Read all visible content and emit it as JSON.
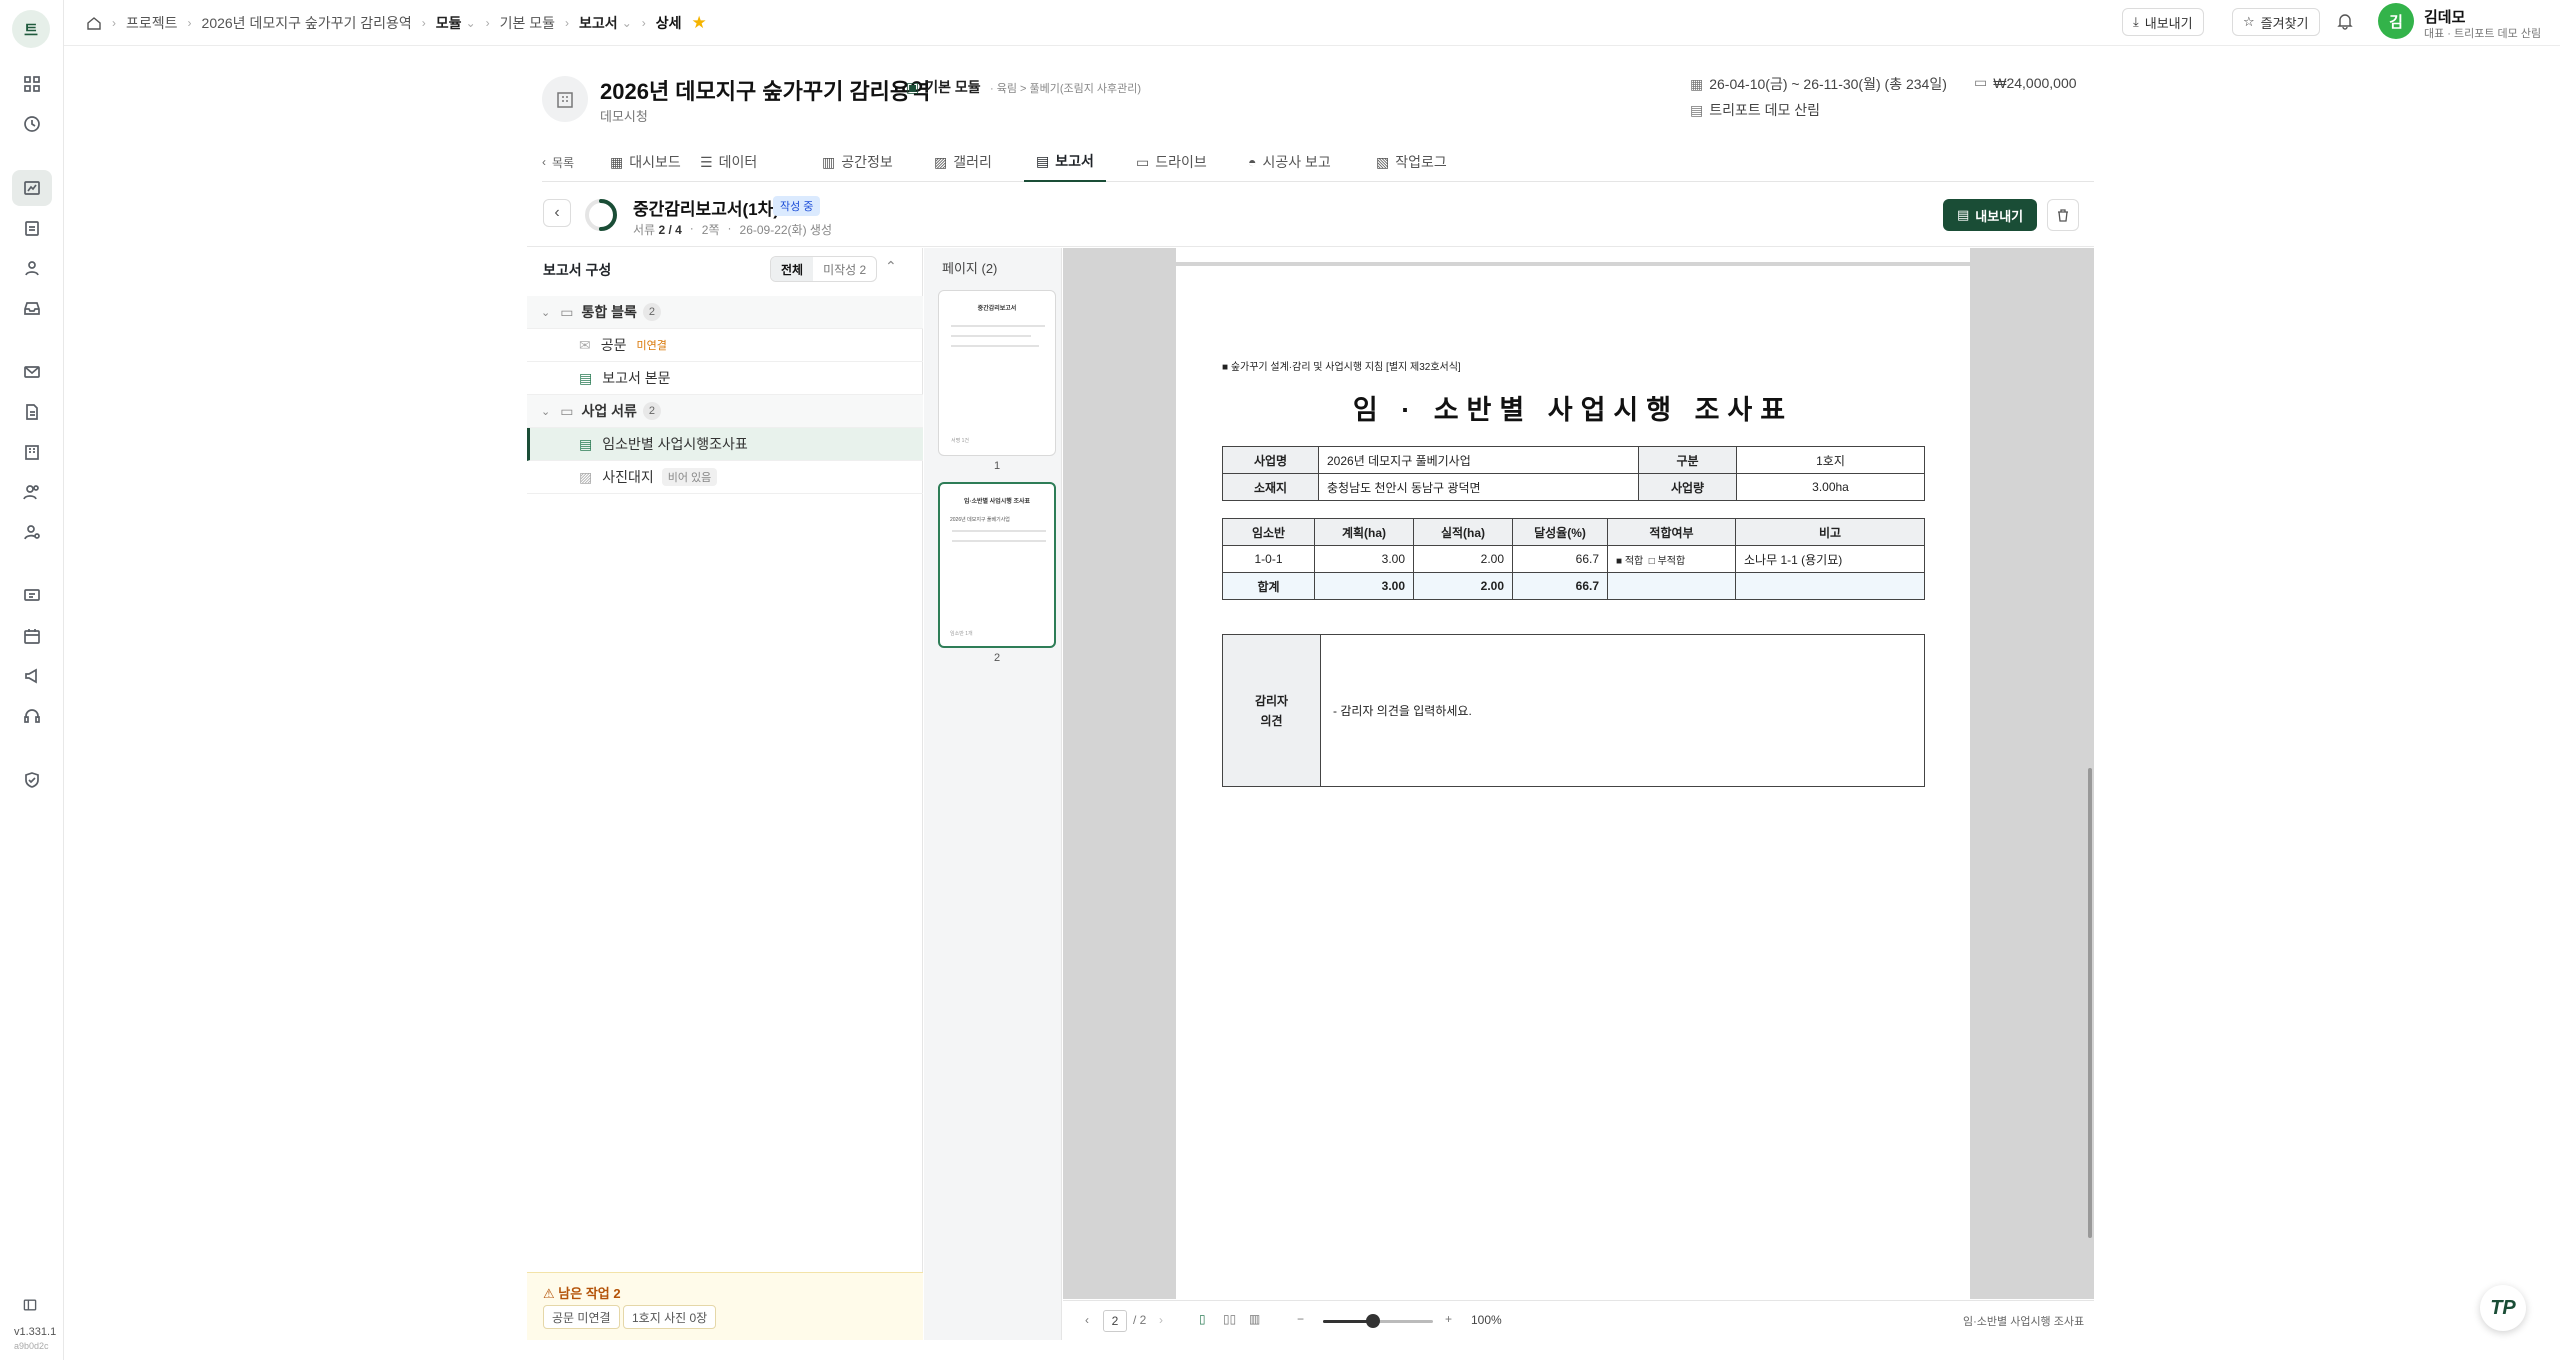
{
  "rail": {
    "logo": "트",
    "version": "v1.331.1",
    "build": "a9b0d2c"
  },
  "breadcrumb": {
    "items": [
      "프로젝트",
      "2026년 데모지구 숲가꾸기 감리용역",
      "모듈",
      "기본 모듈",
      "보고서",
      "상세"
    ]
  },
  "topbar": {
    "export_label": "내보내기",
    "favorite_label": "즐겨찾기",
    "avatar_letter": "김",
    "user_name": "김데모",
    "user_role": "대표 · 트리포트 데모 산림"
  },
  "project": {
    "title": "2026년 데모지구 숲가꾸기 감리용역",
    "client": "데모시청",
    "module_label": "기본 모듈",
    "module_path": "· 육림 > 풀베기(조림지 사후관리)",
    "period": "26-04-10(금) ~ 26-11-30(월) (총 234일)",
    "amount": "₩24,000,000",
    "company": "트리포트 데모 산림"
  },
  "tabs": {
    "back_label": "목록",
    "items": [
      "대시보드",
      "데이터",
      "공간정보",
      "갤러리",
      "보고서",
      "드라이브",
      "시공사 보고",
      "작업로그"
    ]
  },
  "report": {
    "title": "중간감리보고서(1차)",
    "status": "작성 중",
    "docs_label": "서류",
    "docs_value": "2 / 4",
    "pages": "2쪽",
    "created": "26-09-22(화) 생성",
    "export_label": "내보내기"
  },
  "tree": {
    "title": "보고서 구성",
    "filter_all": "전체",
    "filter_pending": "미작성 2",
    "groups": [
      {
        "label": "통합 블록",
        "count": "2"
      },
      {
        "label": "사업 서류",
        "count": "2"
      }
    ],
    "items": [
      {
        "label": "공문",
        "tag": "미연결"
      },
      {
        "label": "보고서 본문",
        "tag": ""
      },
      {
        "label": "임소반별 사업시행조사표",
        "tag": ""
      },
      {
        "label": "사진대지",
        "tag": "비어 있음"
      }
    ],
    "footer_title": "남은 작업 2",
    "footer_chips": [
      "공문 미연결",
      "1호지 사진 0장"
    ]
  },
  "thumbs": {
    "title": "페이지 (2)",
    "pages": [
      {
        "num": "1",
        "title": "중간감리보고서",
        "foot": "서명 1건"
      },
      {
        "num": "2",
        "title": "임·소반별 사업시행 조사표",
        "sub": "2026년 데모지구 풀베기사업",
        "foot": "임소반 1개"
      }
    ]
  },
  "doc": {
    "note": "■ 숲가꾸기 설계·감리 및 사업시행 지침 [별지 제32호서식]",
    "title": "임 · 소반별 사업시행 조사표",
    "info": {
      "project_label": "사업명",
      "project_value": "2026년 데모지구 풀베기사업",
      "type_label": "구분",
      "type_value": "1호지",
      "location_label": "소재지",
      "location_value": "충청남도 천안시 동남구 광덕면",
      "amount_label": "사업량",
      "amount_value": "3.00ha"
    },
    "table": {
      "headers": [
        "임소반",
        "계획(ha)",
        "실적(ha)",
        "달성율(%)",
        "적합여부",
        "비고"
      ],
      "rows": [
        {
          "cells": [
            "1-0-1",
            "3.00",
            "2.00",
            "66.7",
            "■ 적합  □ 부적합",
            "소나무 1-1 (용기묘)"
          ]
        }
      ],
      "total": [
        "합계",
        "3.00",
        "2.00",
        "66.7",
        "",
        ""
      ]
    },
    "opinion_label_1": "감리자",
    "opinion_label_2": "의견",
    "opinion_text": "- 감리자 의견을 입력하세요."
  },
  "viewer": {
    "page_current": "2",
    "page_total": "/ 2",
    "zoom_label": "100%",
    "zoom_level": 0.45,
    "doc_name": "임·소반별 사업시행 조사표"
  }
}
